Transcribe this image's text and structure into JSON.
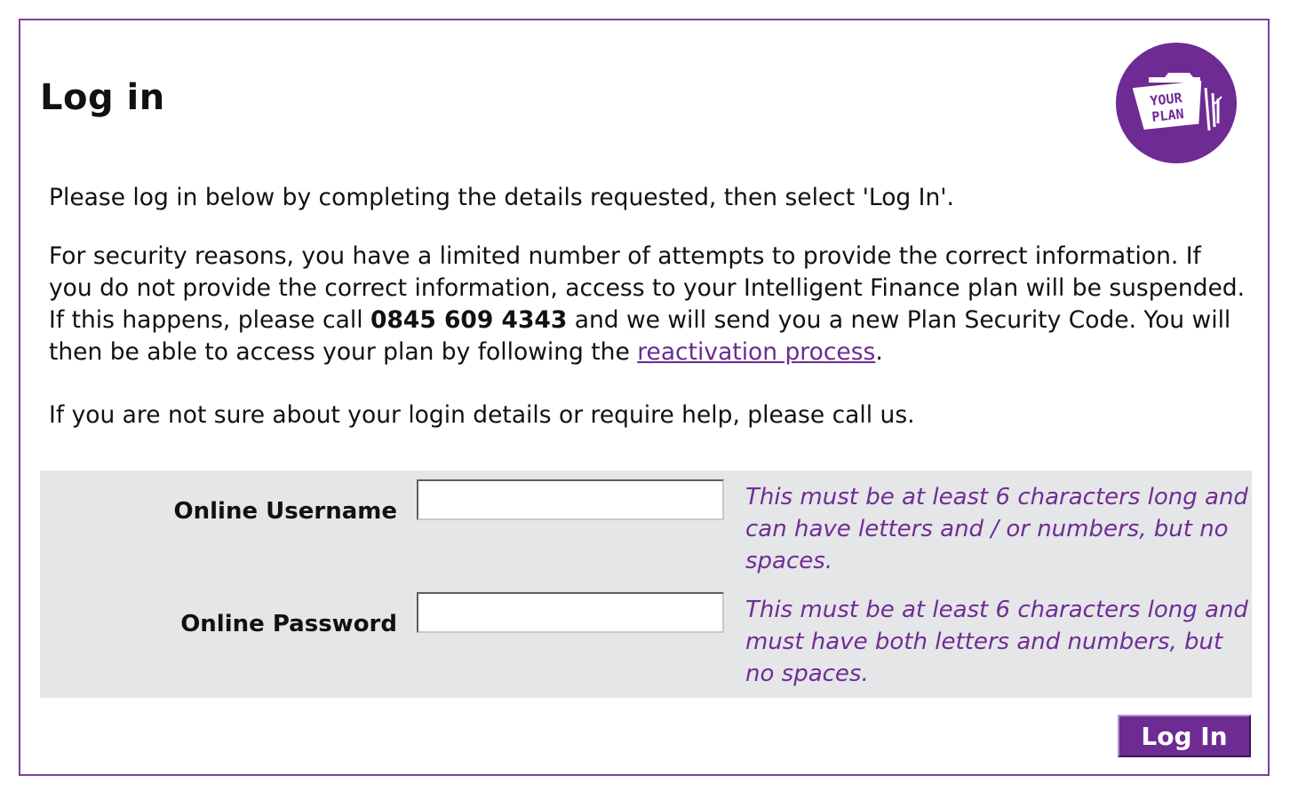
{
  "page": {
    "title": "Log in"
  },
  "logo": {
    "line1": "YOUR",
    "line2": "PLAN",
    "icon": "your-plan-folder-icon",
    "color": "#6e2b93"
  },
  "intro": {
    "p1": "Please log in below by completing the details requested, then select 'Log In'.",
    "p2_before": "For security reasons, you have a limited number of attempts to provide the correct information. If you do not provide the correct information, access to your Intelligent Finance plan will be suspended. If this happens, please call ",
    "phone": "0845 609 4343",
    "p2_middle": " and we will send you a new Plan Security Code. You will then be able to access your plan by following the ",
    "link_text": "reactivation process",
    "p2_after": ".",
    "p3": "If you are not sure about your login details or require help, please call us."
  },
  "form": {
    "username_label": "Online Username",
    "username_value": "",
    "username_hint": "This must be at least 6 characters long and can have letters and / or numbers, but no spaces.",
    "password_label": "Online Password",
    "password_value": "",
    "password_hint": "This must be at least 6 characters long and must have both letters and numbers, but no spaces.",
    "submit_label": "Log In"
  },
  "colors": {
    "accent": "#6e2b93",
    "border": "#7b3f9e",
    "form_background": "#e5e6e8"
  }
}
